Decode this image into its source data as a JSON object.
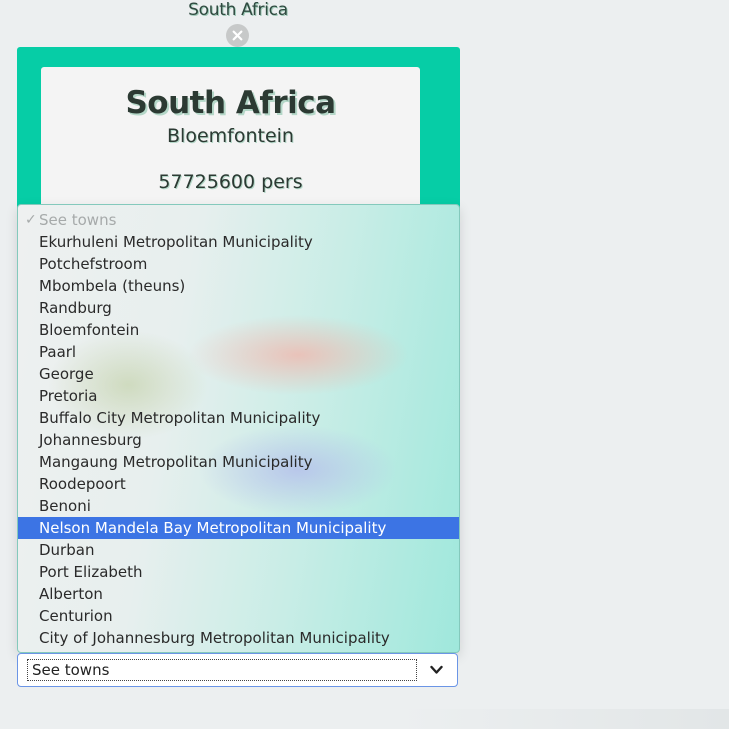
{
  "header": {
    "title": "South Africa",
    "close_icon": "close-icon"
  },
  "card": {
    "country": "South Africa",
    "capital": "Bloemfontein",
    "population": "57725600 pers"
  },
  "dropdown": {
    "placeholder": "See towns",
    "check_icon": "✓",
    "selected_index": 14,
    "items": [
      "See towns",
      "Ekurhuleni Metropolitan Municipality",
      "Potchefstroom",
      "Mbombela (theuns)",
      "Randburg",
      "Bloemfontein",
      "Paarl",
      "George",
      "Pretoria",
      "Buffalo City Metropolitan Municipality",
      "Johannesburg",
      "Mangaung Metropolitan Municipality",
      "Roodepoort",
      "Benoni",
      "Nelson Mandela Bay Metropolitan Municipality",
      "Durban",
      "Port Elizabeth",
      "Alberton",
      "Centurion",
      "City of Johannesburg Metropolitan Municipality"
    ]
  },
  "select": {
    "value": "See towns",
    "chevron_icon": "chevron-down-icon"
  },
  "colors": {
    "accent": "#06cda6",
    "highlight": "#3c74e4"
  }
}
